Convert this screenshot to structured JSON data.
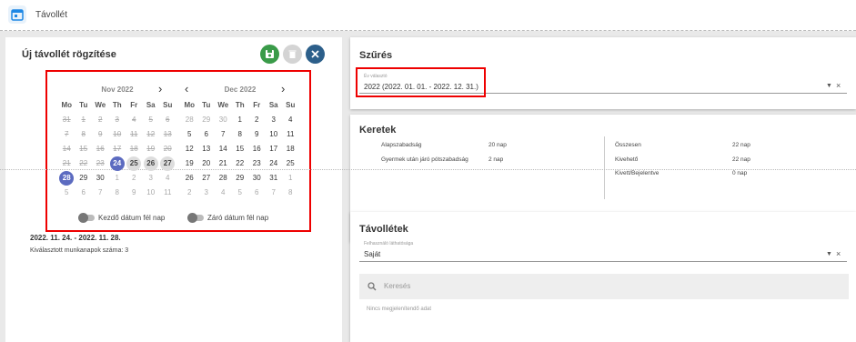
{
  "app": {
    "title": "Távollét",
    "icon": "calendar-icon"
  },
  "left": {
    "title": "Új távollét rögzítése",
    "months": [
      {
        "name": "Nov 2022",
        "weekdays": [
          "Mo",
          "Tu",
          "We",
          "Th",
          "Fr",
          "Sa",
          "Su"
        ],
        "weeks": [
          [
            "31",
            "1",
            "2",
            "3",
            "4",
            "5",
            "6"
          ],
          [
            "7",
            "8",
            "9",
            "10",
            "11",
            "12",
            "13"
          ],
          [
            "14",
            "15",
            "16",
            "17",
            "18",
            "19",
            "20"
          ],
          [
            "21",
            "22",
            "23",
            "24",
            "25",
            "26",
            "27"
          ],
          [
            "28",
            "29",
            "30",
            "1",
            "2",
            "3",
            "4"
          ],
          [
            "5",
            "6",
            "7",
            "8",
            "9",
            "10",
            "11"
          ]
        ]
      },
      {
        "name": "Dec 2022",
        "weekdays": [
          "Mo",
          "Tu",
          "We",
          "Th",
          "Fr",
          "Sa",
          "Su"
        ],
        "weeks": [
          [
            "28",
            "29",
            "30",
            "1",
            "2",
            "3",
            "4"
          ],
          [
            "5",
            "6",
            "7",
            "8",
            "9",
            "10",
            "11"
          ],
          [
            "12",
            "13",
            "14",
            "15",
            "16",
            "17",
            "18"
          ],
          [
            "19",
            "20",
            "21",
            "22",
            "23",
            "24",
            "25"
          ],
          [
            "26",
            "27",
            "28",
            "29",
            "30",
            "31",
            "1"
          ],
          [
            "2",
            "3",
            "4",
            "5",
            "6",
            "7",
            "8"
          ]
        ]
      }
    ],
    "toggle_start": "Kezdő dátum fél nap",
    "toggle_end": "Záró dátum fél nap",
    "selected_range": "2022. 11. 24. - 2022. 11. 28.",
    "workdays_text": "Kiválasztott munkanapok száma: 3"
  },
  "filter": {
    "title": "Szűrés",
    "year_label": "Év választó",
    "year_value": "2022 (2022. 01. 01. - 2022. 12. 31.)"
  },
  "frames": {
    "title": "Keretek",
    "left_items": [
      {
        "label": "Alapszabadság",
        "value": "20 nap"
      },
      {
        "label": "Gyermek után járó pótszabadság",
        "value": "2 nap"
      }
    ],
    "right_items": [
      {
        "label": "Összesen",
        "value": "22 nap"
      },
      {
        "label": "Kivehető",
        "value": "22 nap"
      },
      {
        "label": "Kivett/Bejelentve",
        "value": "0 nap"
      }
    ]
  },
  "absences": {
    "title": "Távollétek",
    "visibility_label": "Felhasználó láthatósága",
    "visibility_value": "Saját",
    "search_placeholder": "Keresés",
    "empty_text": "Nincs megjelenítendő adat"
  },
  "colors": {
    "accent": "#5c6bc0",
    "save": "#3a9b49",
    "close": "#2c5f8a",
    "highlight": "#e00000"
  }
}
